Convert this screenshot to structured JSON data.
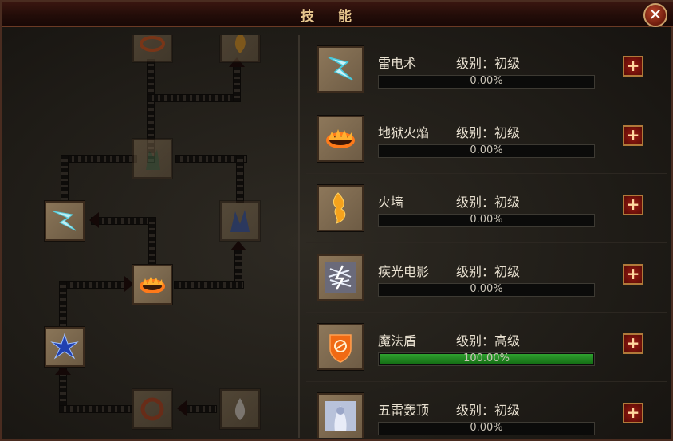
{
  "window": {
    "title": "技能",
    "close_label": "✕"
  },
  "tree": {
    "nodes": [
      {
        "name": "tree-node-hellfire-top",
        "icon": "fire-ring-icon"
      },
      {
        "name": "tree-node-flame-top",
        "icon": "flame-icon"
      },
      {
        "name": "tree-node-shadow",
        "icon": "shadow-figure-icon"
      },
      {
        "name": "tree-node-lightning",
        "icon": "lightning-icon"
      },
      {
        "name": "tree-node-blue-storm",
        "icon": "blue-storm-icon"
      },
      {
        "name": "tree-node-hell-fire",
        "icon": "fire-ring-icon"
      },
      {
        "name": "tree-node-blue-burst",
        "icon": "blue-burst-icon"
      },
      {
        "name": "tree-node-fire-circle",
        "icon": "fire-circle-icon"
      },
      {
        "name": "tree-node-white-flame",
        "icon": "white-flame-icon"
      }
    ]
  },
  "skills": [
    {
      "name": "雷电术",
      "level": "级别：初级",
      "progress": 0.0,
      "progress_text": "0.00%",
      "icon": "lightning-icon"
    },
    {
      "name": "地狱火焰",
      "level": "级别：初级",
      "progress": 0.0,
      "progress_text": "0.00%",
      "icon": "fire-ring-icon"
    },
    {
      "name": "火墙",
      "level": "级别：初级",
      "progress": 0.0,
      "progress_text": "0.00%",
      "icon": "fire-wall-icon"
    },
    {
      "name": "疾光电影",
      "level": "级别：初级",
      "progress": 0.0,
      "progress_text": "0.00%",
      "icon": "light-beam-icon"
    },
    {
      "name": "魔法盾",
      "level": "级别：高级",
      "progress": 1.0,
      "progress_text": "100.00%",
      "icon": "magic-shield-icon"
    },
    {
      "name": "五雷轰顶",
      "level": "级别：初级",
      "progress": 0.0,
      "progress_text": "0.00%",
      "icon": "thunder-icon"
    }
  ],
  "plus_label": "+",
  "colors": {
    "accent": "#e6c68e",
    "progress_fill": "#2fa12f",
    "plus_bg": "#9b1b12"
  }
}
